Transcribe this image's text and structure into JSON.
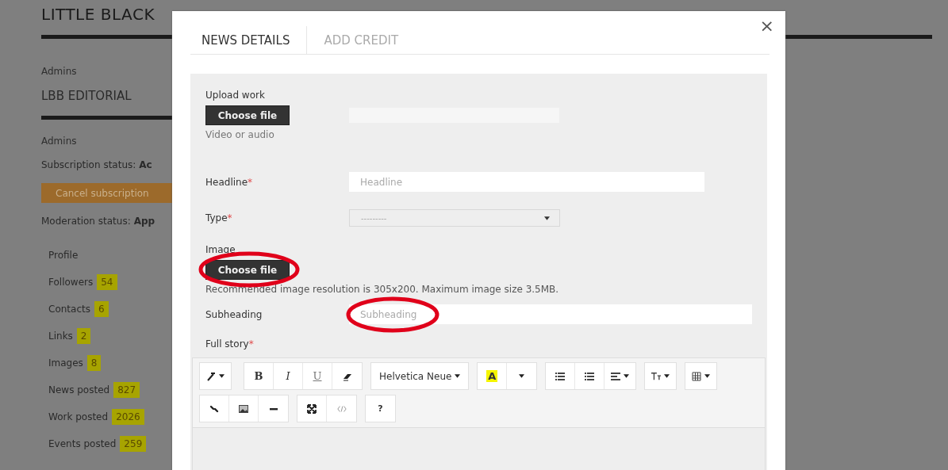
{
  "page": {
    "title": "LITTLE BLACK",
    "sections": [
      {
        "kind": "label",
        "text": "Admins"
      },
      {
        "kind": "heading",
        "text": "LBB EDITORIAL"
      },
      {
        "kind": "label",
        "text": "Admins"
      },
      {
        "kind": "status",
        "label": "Subscription status:",
        "value": "Ac"
      },
      {
        "kind": "button",
        "text": "Cancel subscription"
      },
      {
        "kind": "status",
        "label": "Moderation status:",
        "value": "App"
      }
    ],
    "stats": [
      {
        "label": "Profile"
      },
      {
        "label": "Followers",
        "count": "54"
      },
      {
        "label": "Contacts",
        "count": "6"
      },
      {
        "label": "Links",
        "count": "2"
      },
      {
        "label": "Images",
        "count": "8"
      },
      {
        "label": "News posted",
        "count": "827"
      },
      {
        "label": "Work posted",
        "count": "2026"
      },
      {
        "label": "Events posted",
        "count": "259"
      }
    ]
  },
  "modal": {
    "close": "×",
    "tabs": [
      {
        "label": "NEWS DETAILS",
        "selected": true
      },
      {
        "label": "ADD CREDIT",
        "selected": false
      }
    ],
    "fields": [
      {
        "kind": "file",
        "label": "Upload work",
        "button": "Choose file",
        "hint": "Video or audio",
        "filename_box": true,
        "circled": false
      },
      {
        "kind": "text",
        "label": "Headline",
        "required_mark": "*",
        "placeholder": "Headline",
        "circled": false
      },
      {
        "kind": "select",
        "label": "Type",
        "required_mark": "*",
        "value": "---------"
      },
      {
        "kind": "file",
        "label": "Image",
        "button": "Choose file",
        "hint": "Recommended image resolution is 305x200. Maximum image size 3.5MB.",
        "filename_box": false,
        "circled": true
      },
      {
        "kind": "text",
        "label": "Subheading",
        "placeholder": "Subheading",
        "circled": true
      },
      {
        "kind": "editor",
        "label": "Full story",
        "required_mark": "*",
        "toolbar": [
          [
            [
              {
                "kind": "wand",
                "caret": true
              }
            ],
            [
              {
                "kind": "bold",
                "text": "B"
              },
              {
                "kind": "italic",
                "text": "I"
              },
              {
                "kind": "underline",
                "text": "U"
              },
              {
                "kind": "eraser"
              }
            ],
            [
              {
                "kind": "font",
                "text": "Helvetica Neue",
                "caret": true
              }
            ],
            [
              {
                "kind": "highlight",
                "text": "A"
              },
              {
                "kind": "caret-only",
                "caret": true
              }
            ],
            [
              {
                "kind": "bullets"
              },
              {
                "kind": "numbers"
              },
              {
                "kind": "align",
                "caret": true
              }
            ],
            [
              {
                "kind": "textsize",
                "caret": true
              }
            ],
            [
              {
                "kind": "table",
                "caret": true
              }
            ]
          ],
          [
            [
              {
                "kind": "link"
              },
              {
                "kind": "image"
              },
              {
                "kind": "rule"
              }
            ],
            [
              {
                "kind": "fullscreen"
              },
              {
                "kind": "code"
              }
            ],
            [
              {
                "kind": "help",
                "text": "?"
              }
            ]
          ]
        ]
      }
    ]
  }
}
